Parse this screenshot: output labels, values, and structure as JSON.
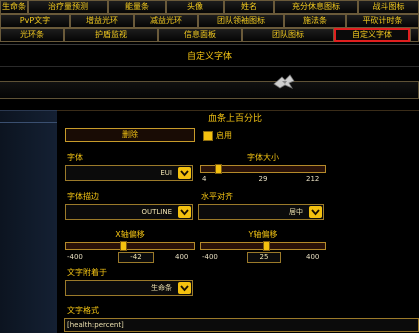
{
  "tabs_row1": [
    "生命条",
    "治疗量预测",
    "能量条",
    "头像",
    "姓名",
    "充分休息图标",
    "战斗图标"
  ],
  "tabs_row2": [
    "PvP文字",
    "增益光环",
    "减益光环",
    "团队领袖图标",
    "施法条",
    "平砍计时条"
  ],
  "tabs_row3": [
    "光环条",
    "护盾监视",
    "信息面板",
    "团队图标",
    "自定义字体"
  ],
  "active_tab": "自定义字体",
  "section_title": "自定义字体",
  "panel": {
    "heading": "血条上百分比",
    "delete_button": "删除",
    "enable_label": "启用",
    "enabled": true,
    "font": {
      "label": "字体",
      "value": "EUI"
    },
    "font_size": {
      "label": "字体大小",
      "min": "4",
      "value": "29",
      "max": "212",
      "fraction": 0.12
    },
    "outline": {
      "label": "字体描边",
      "value": "OUTLINE"
    },
    "halign": {
      "label": "水平对齐",
      "value": "居中"
    },
    "x_offset": {
      "label": "X轴偏移",
      "min": "-400",
      "value": "-42",
      "max": "400",
      "fraction": 0.45
    },
    "y_offset": {
      "label": "Y轴偏移",
      "min": "-400",
      "value": "25",
      "max": "400",
      "fraction": 0.53
    },
    "attach": {
      "label": "文字附着于",
      "value": "生命条"
    },
    "format": {
      "label": "文字格式",
      "value": "[health:percent]"
    }
  },
  "colors": {
    "accent": "#f4c10f",
    "active_border": "#e01f1f",
    "text": "#f5c514"
  }
}
